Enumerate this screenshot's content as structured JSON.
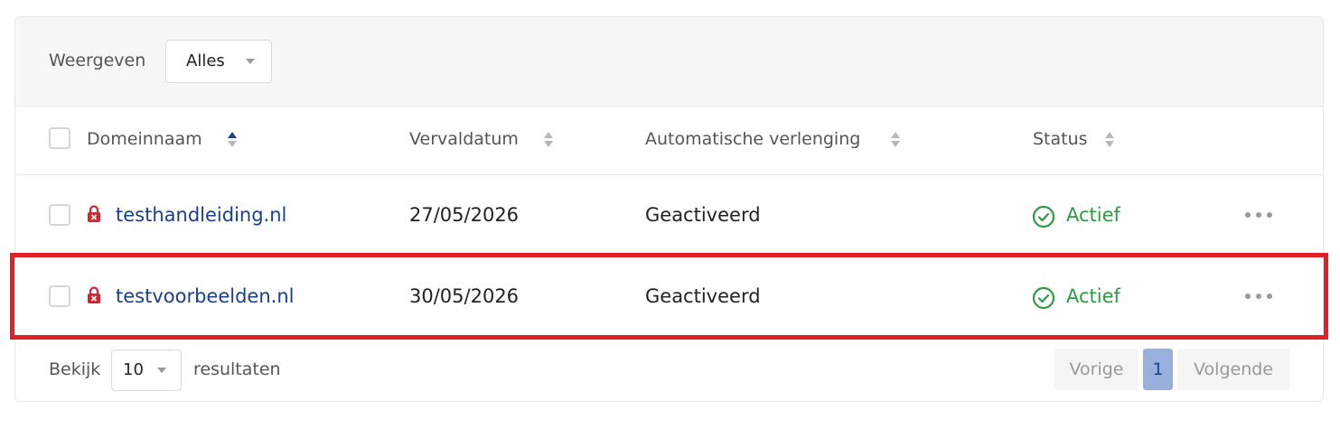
{
  "filter": {
    "label": "Weergeven",
    "selected": "Alles"
  },
  "columns": {
    "domain": "Domeinnaam",
    "expiry": "Vervaldatum",
    "auto_renew": "Automatische verlenging",
    "status": "Status"
  },
  "rows": [
    {
      "domain": "testhandleiding.nl",
      "expiry": "27/05/2026",
      "auto_renew": "Geactiveerd",
      "status": "Actief"
    },
    {
      "domain": "testvoorbeelden.nl",
      "expiry": "30/05/2026",
      "auto_renew": "Geactiveerd",
      "status": "Actief"
    }
  ],
  "footer": {
    "show_label": "Bekijk",
    "page_size": "10",
    "results_label": "resultaten"
  },
  "pagination": {
    "prev": "Vorige",
    "current": "1",
    "next": "Volgende"
  },
  "colors": {
    "link": "#1b3f8f",
    "status_active": "#2f9a45",
    "lock": "#d9232e",
    "highlight": "#e31e24",
    "current_page_bg": "#9ab0dc"
  },
  "icons": {
    "lock": "lock-icon",
    "status": "check-circle-icon",
    "more": "more-horizontal-icon",
    "sort": "sort-icon",
    "dropdown": "chevron-down-icon"
  }
}
